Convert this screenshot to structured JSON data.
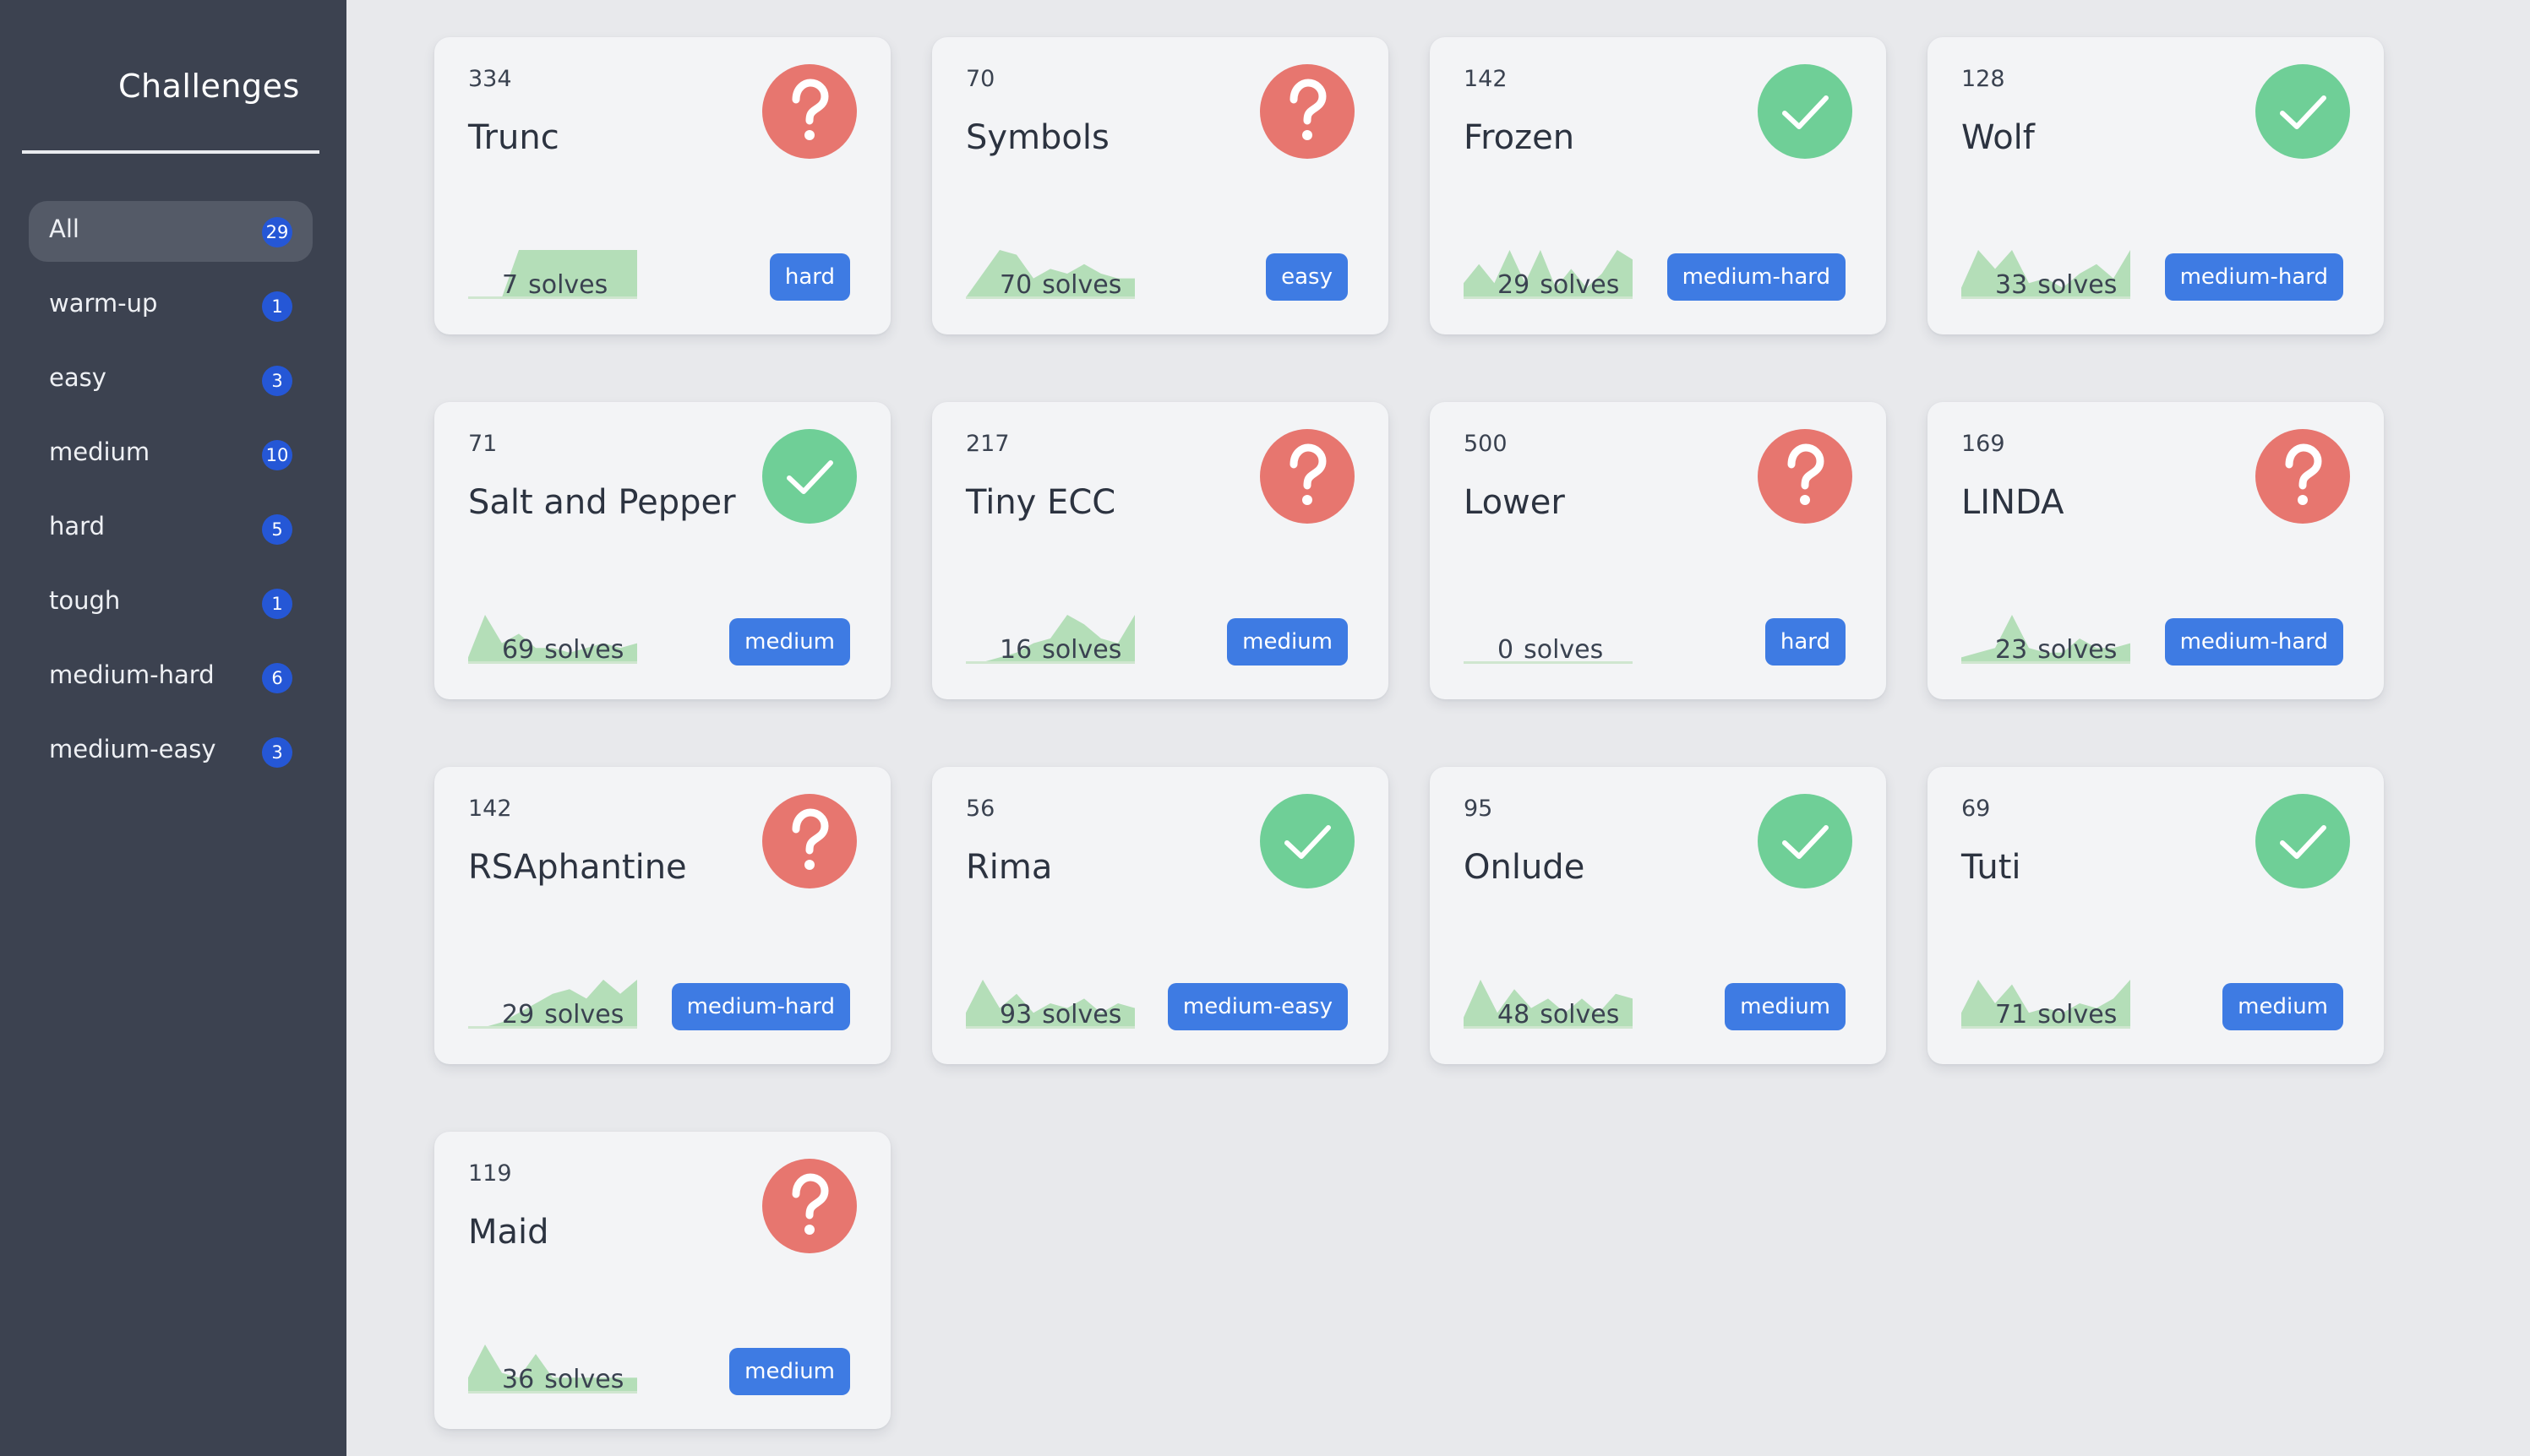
{
  "sidebar": {
    "title": "Challenges",
    "categories": [
      {
        "label": "All",
        "count": "29",
        "active": true
      },
      {
        "label": "warm-up",
        "count": "1"
      },
      {
        "label": "easy",
        "count": "3"
      },
      {
        "label": "medium",
        "count": "10"
      },
      {
        "label": "hard",
        "count": "5"
      },
      {
        "label": "tough",
        "count": "1"
      },
      {
        "label": "medium-hard",
        "count": "6"
      },
      {
        "label": "medium-easy",
        "count": "3"
      }
    ]
  },
  "cards": [
    {
      "points": "334",
      "name": "Trunc",
      "solved": false,
      "solves": "7",
      "solves_label": "solves",
      "tag": "hard",
      "trend": [
        0,
        0,
        0,
        1,
        1,
        1,
        1,
        1,
        1,
        1,
        1
      ]
    },
    {
      "points": "70",
      "name": "Symbols",
      "solved": false,
      "solves": "70",
      "solves_label": "solves",
      "tag": "easy",
      "trend": [
        0,
        0.5,
        1,
        0.9,
        0.4,
        0.6,
        0.5,
        0.7,
        0.5,
        0.4,
        0.4
      ]
    },
    {
      "points": "142",
      "name": "Frozen",
      "solved": true,
      "solves": "29",
      "solves_label": "solves",
      "tag": "medium-hard",
      "trend": [
        0.3,
        0.7,
        0.3,
        1,
        0.3,
        1,
        0.2,
        0.6,
        0.2,
        0.5,
        1,
        0.8
      ]
    },
    {
      "points": "128",
      "name": "Wolf",
      "solved": true,
      "solves": "33",
      "solves_label": "solves",
      "tag": "medium-hard",
      "trend": [
        0.2,
        1,
        0.6,
        1,
        0.3,
        0.4,
        0.2,
        0.5,
        0.7,
        0.4,
        1
      ]
    },
    {
      "points": "71",
      "name": "Salt and Pepper",
      "solved": true,
      "solves": "69",
      "solves_label": "solves",
      "tag": "medium",
      "trend": [
        0.1,
        1,
        0.4,
        0.6,
        0.3,
        0.3,
        0.2,
        0.3,
        0.4,
        0.3,
        0.4
      ]
    },
    {
      "points": "217",
      "name": "Tiny ECC",
      "solved": false,
      "solves": "16",
      "solves_label": "solves",
      "tag": "medium",
      "trend": [
        0,
        0,
        0.1,
        0.2,
        0.4,
        0.5,
        1,
        0.8,
        0.5,
        0.4,
        1
      ]
    },
    {
      "points": "500",
      "name": "Lower",
      "solved": false,
      "solves": "0",
      "solves_label": "solves",
      "tag": "hard",
      "trend": [
        0,
        0,
        0,
        0,
        0,
        0,
        0,
        0,
        0,
        0,
        0
      ]
    },
    {
      "points": "169",
      "name": "LINDA",
      "solved": false,
      "solves": "23",
      "solves_label": "solves",
      "tag": "medium-hard",
      "trend": [
        0.1,
        0.2,
        0.3,
        1,
        0.3,
        0.2,
        0.2,
        0.5,
        0.3,
        0.3,
        0.4
      ]
    },
    {
      "points": "142",
      "name": "RSAphantine",
      "solved": false,
      "solves": "29",
      "solves_label": "solves",
      "tag": "medium-hard",
      "trend": [
        0,
        0,
        0.1,
        0.3,
        0.5,
        0.7,
        0.8,
        0.6,
        1,
        0.7,
        1
      ]
    },
    {
      "points": "56",
      "name": "Rima",
      "solved": true,
      "solves": "93",
      "solves_label": "solves",
      "tag": "medium-easy",
      "trend": [
        0.3,
        1,
        0.4,
        0.7,
        0.3,
        0.5,
        0.4,
        0.6,
        0.3,
        0.5,
        0.4
      ]
    },
    {
      "points": "95",
      "name": "Onlude",
      "solved": true,
      "solves": "48",
      "solves_label": "solves",
      "tag": "medium",
      "trend": [
        0.2,
        1,
        0.3,
        0.8,
        0.4,
        0.6,
        0.3,
        0.6,
        0.3,
        0.7,
        0.6
      ]
    },
    {
      "points": "69",
      "name": "Tuti",
      "solved": true,
      "solves": "71",
      "solves_label": "solves",
      "tag": "medium",
      "trend": [
        0.3,
        1,
        0.5,
        0.9,
        0.3,
        0.4,
        0.3,
        0.5,
        0.4,
        0.6,
        1
      ]
    },
    {
      "points": "119",
      "name": "Maid",
      "solved": false,
      "solves": "36",
      "solves_label": "solves",
      "tag": "medium",
      "trend": [
        0.3,
        1,
        0.4,
        0.3,
        0.8,
        0.3,
        0.3,
        0.3,
        0.3,
        0.3,
        0.3
      ]
    }
  ],
  "colors": {
    "sidebar_bg": "#3c4250",
    "count_badge": "#2557d6",
    "tag_bg": "#3e7be3",
    "unsolved": "#e7766f",
    "solved": "#6fcf97",
    "spark_fill": "#a8d9ad"
  },
  "icons": {
    "unsolved": "question-mark-icon",
    "solved": "checkmark-icon"
  }
}
